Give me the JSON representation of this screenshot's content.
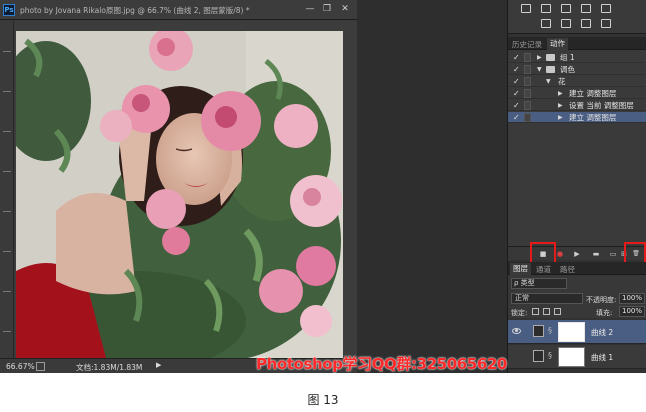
{
  "document": {
    "ps_logo": "Ps",
    "title": "photo by Jovana Rikalo原图.jpg @ 66.7% (曲线 2, 图层蒙版/8) *",
    "min_glyph": "—",
    "max_glyph": "❐",
    "close_glyph": "✕",
    "zoom": "66.67%",
    "doc_size": "文档:1.83M/1.83M",
    "arrow_glyph": "▶"
  },
  "actions_panel": {
    "tabs": [
      "历史记录",
      "动作"
    ],
    "active_tab": "动作",
    "rows": [
      {
        "check": "✓",
        "toggle": "▶",
        "label": "组 1",
        "indent": 0,
        "folder": true
      },
      {
        "check": "✓",
        "toggle": "▼",
        "label": "调色",
        "indent": 0,
        "folder": true
      },
      {
        "check": "✓",
        "toggle": "▼",
        "label": "花",
        "indent": 1,
        "folder": false
      },
      {
        "check": "✓",
        "toggle": "▶",
        "label": "建立 调整图层",
        "indent": 2,
        "folder": false
      },
      {
        "check": "✓",
        "toggle": "▶",
        "label": "设置 当前 调整图层",
        "indent": 2,
        "folder": false
      },
      {
        "check": "✓",
        "toggle": "▶",
        "label": "建立 调整图层",
        "indent": 2,
        "folder": false,
        "selected": true
      }
    ],
    "toolbar_glyphs": [
      "■",
      "●",
      "▶",
      "▬",
      "▭",
      "⊞",
      "🗑"
    ],
    "highlighted": [
      "stop-button",
      "delete-button"
    ]
  },
  "layers_panel": {
    "tabs": [
      "图层",
      "通道",
      "路径"
    ],
    "active_tab": "图层",
    "kind_filter": "ρ 类型",
    "blend_mode": "正常",
    "opacity_label": "不透明度:",
    "opacity_value": "100%",
    "lock_label": "锁定:",
    "fill_label": "填充:",
    "fill_value": "100%",
    "layers": [
      {
        "name": "曲线 2",
        "selected": true
      },
      {
        "name": "曲线 1",
        "selected": false
      }
    ]
  },
  "watermark": "Photoshop学习QQ群:325065620",
  "caption": "图 13",
  "colors": {
    "highlight_box": "#e51a1a",
    "selection": "#4a5d82",
    "watermark": "#ff2828"
  }
}
